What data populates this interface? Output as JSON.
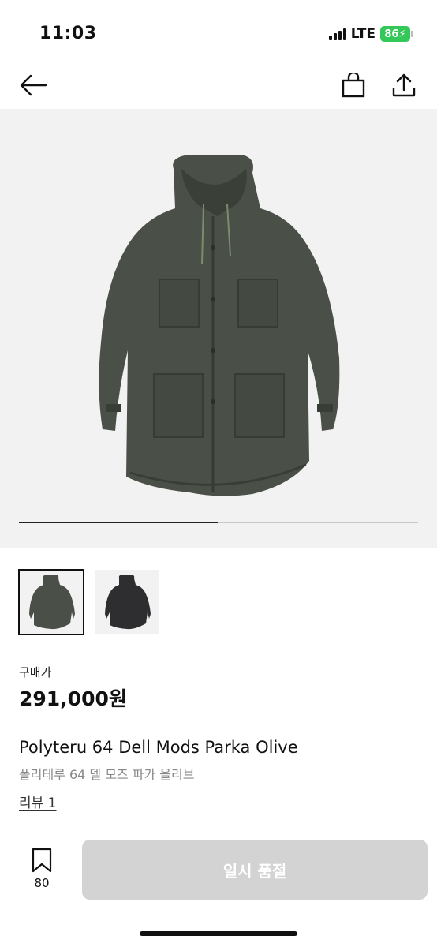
{
  "status_bar": {
    "time": "11:03",
    "network": "LTE",
    "battery": "86"
  },
  "nav": {
    "back_icon": "arrow-left-icon",
    "cart_icon": "shopping-bag-icon",
    "share_icon": "share-icon"
  },
  "gallery": {
    "image_count": 2,
    "current_index": 1,
    "progress_fraction": 0.5,
    "thumbnails": [
      {
        "label": "olive",
        "selected": true
      },
      {
        "label": "black",
        "selected": false
      }
    ]
  },
  "product": {
    "price_label": "구매가",
    "price": "291,000원",
    "title": "Polyteru 64 Dell Mods Parka Olive",
    "subtitle": "폴리테루 64 델 모즈 파카 올리브",
    "review_link": "리뷰 1"
  },
  "bottom_bar": {
    "bookmark_count": "80",
    "buy_button_label": "일시 품절"
  },
  "colors": {
    "battery": "#34c759",
    "disabled_button": "#d3d3d3",
    "image_bg": "#f2f2f2",
    "jacket_olive": "#4a5047",
    "jacket_black": "#2e2e30"
  }
}
